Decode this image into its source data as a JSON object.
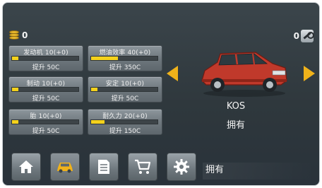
{
  "topbar": {
    "coins": "0",
    "parts": "0"
  },
  "upgrades": [
    {
      "name": "发动机 10(+0)",
      "button": "提升 50C",
      "level": 0.1
    },
    {
      "name": "燃油效率 40(+0)",
      "button": "提升 350C",
      "level": 0.4
    },
    {
      "name": "制动 10(+0)",
      "button": "提升 50C",
      "level": 0.1
    },
    {
      "name": "安定 10(+0)",
      "button": "提升 50C",
      "level": 0.1
    },
    {
      "name": "胎 10(+0)",
      "button": "提升 50C",
      "level": 0.1
    },
    {
      "name": "耐久力 20(+0)",
      "button": "提升 150C",
      "level": 0.2
    }
  ],
  "car": {
    "name": "KOS",
    "status": "拥有",
    "body_color": "#c0392b"
  },
  "bottom": {
    "status": "拥有"
  },
  "colors": {
    "accent": "#f0b21a",
    "bar_fill": "#f5d21c"
  },
  "nav": [
    "home-icon",
    "car-icon",
    "list-icon",
    "cart-icon",
    "settings-icon"
  ]
}
